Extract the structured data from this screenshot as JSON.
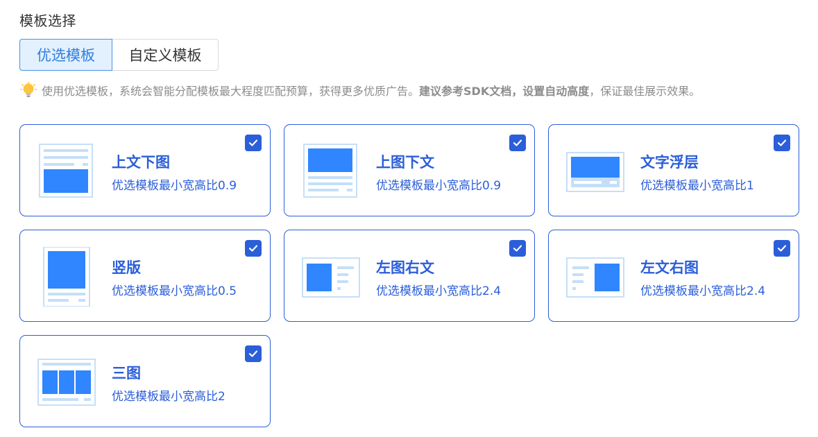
{
  "section_title": "模板选择",
  "tabs": [
    {
      "label": "优选模板",
      "selected": true
    },
    {
      "label": "自定义模板",
      "selected": false
    }
  ],
  "hint": {
    "icon": "lightbulb-icon",
    "part1": "使用优选模板，系统会智能分配模板最大程度匹配预算，获得更多优质广告。",
    "bold1": "建议参考SDK文档",
    "sep": "，",
    "bold2": "设置自动高度",
    "part2": "，保证最佳展示效果。"
  },
  "colors": {
    "accent": "#2b5ed9",
    "thumb_fill": "#2f86ff",
    "thumb_light": "#c5dff8",
    "tab_selected_bg": "#e3f0fd",
    "hint_text": "#8c8c8c"
  },
  "templates": [
    {
      "id": "text-top-image-bottom",
      "name": "上文下图",
      "desc": "优选模板最小宽高比0.9",
      "checked": true
    },
    {
      "id": "image-top-text-bottom",
      "name": "上图下文",
      "desc": "优选模板最小宽高比0.9",
      "checked": true
    },
    {
      "id": "text-overlay",
      "name": "文字浮层",
      "desc": "优选模板最小宽高比1",
      "checked": true
    },
    {
      "id": "vertical",
      "name": "竖版",
      "desc": "优选模板最小宽高比0.5",
      "checked": true
    },
    {
      "id": "image-left-text-right",
      "name": "左图右文",
      "desc": "优选模板最小宽高比2.4",
      "checked": true
    },
    {
      "id": "text-left-image-right",
      "name": "左文右图",
      "desc": "优选模板最小宽高比2.4",
      "checked": true
    },
    {
      "id": "three-images",
      "name": "三图",
      "desc": "优选模板最小宽高比2",
      "checked": true
    }
  ]
}
